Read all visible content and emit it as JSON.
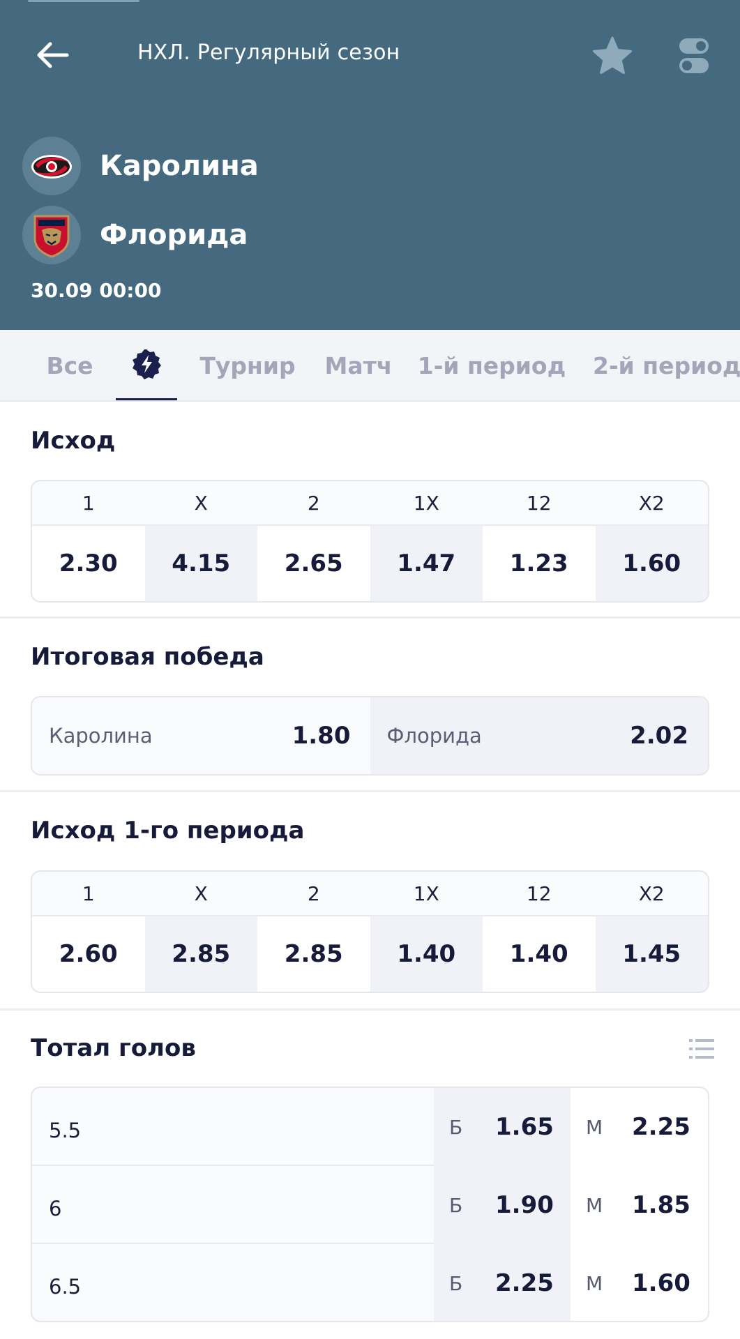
{
  "header": {
    "league_title": "НХЛ. Регулярный сезон",
    "back_icon": "arrow-left-icon",
    "favorite_icon": "star-icon",
    "toggle_icon": "toggle-switch-icon",
    "background_color": "#456a80"
  },
  "teams": [
    {
      "name": "Каролина",
      "logo": "carolina-hurricanes-logo"
    },
    {
      "name": "Флорида",
      "logo": "florida-panthers-logo"
    }
  ],
  "match_time": "30.09 00:00",
  "tabs": [
    {
      "label": "Все"
    },
    {
      "label": "",
      "icon": "lightning-badge-icon",
      "active": true
    },
    {
      "label": "Турнир"
    },
    {
      "label": "Матч"
    },
    {
      "label": "1-й период"
    },
    {
      "label": "2-й период"
    }
  ],
  "outcome": {
    "title": "Исход",
    "headers": [
      "1",
      "X",
      "2",
      "1X",
      "12",
      "X2"
    ],
    "odds": [
      "2.30",
      "4.15",
      "2.65",
      "1.47",
      "1.23",
      "1.60"
    ]
  },
  "final_win": {
    "title": "Итоговая победа",
    "options": [
      {
        "team": "Каролина",
        "odd": "1.80"
      },
      {
        "team": "Флорида",
        "odd": "2.02"
      }
    ]
  },
  "outcome_p1": {
    "title": "Исход 1-го периода",
    "headers": [
      "1",
      "X",
      "2",
      "1X",
      "12",
      "X2"
    ],
    "odds": [
      "2.60",
      "2.85",
      "2.85",
      "1.40",
      "1.40",
      "1.45"
    ]
  },
  "totals": {
    "title": "Тотал голов",
    "icon": "list-icon",
    "over_label": "Б",
    "under_label": "М",
    "rows": [
      {
        "line": "5.5",
        "over": "1.65",
        "under": "2.25"
      },
      {
        "line": "6",
        "over": "1.90",
        "under": "1.85"
      },
      {
        "line": "6.5",
        "over": "2.25",
        "under": "1.60"
      }
    ]
  }
}
